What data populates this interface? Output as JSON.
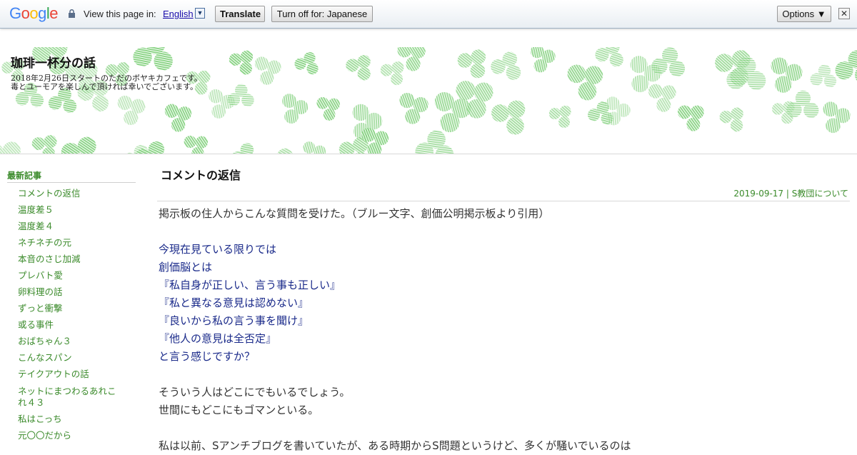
{
  "translate_bar": {
    "logo_letters": [
      "G",
      "o",
      "o",
      "g",
      "l",
      "e"
    ],
    "logo_colors": [
      "#4285f4",
      "#ea4335",
      "#fbbc05",
      "#4285f4",
      "#34a853",
      "#ea4335"
    ],
    "view_text": "View this page in:",
    "language": "English",
    "translate_label": "Translate",
    "turn_off_label": "Turn off for: Japanese",
    "options_label": "Options ▼",
    "close_label": "✕"
  },
  "header": {
    "title": "珈琲一杯分の話",
    "description_lines": [
      "2018年2月26日スタートのただのボヤキカフェです。",
      "毒とユーモアを楽しんで頂ければ幸いでございます。"
    ],
    "pattern_color": "#7fd07a"
  },
  "sidebar": {
    "heading": "最新記事",
    "items": [
      "コメントの返信",
      "温度差５",
      "温度差４",
      "ネチネチの元",
      "本音のさじ加減",
      "プレバト愛",
      "卵料理の話",
      "ずっと衝撃",
      "或る事件",
      "おばちゃん３",
      "こんなスパン",
      "テイクアウトの話",
      "ネットにまつわるあれこ",
      "れ４３",
      "私はこっち",
      "元〇〇だから"
    ]
  },
  "post": {
    "title": "コメントの返信",
    "meta": "2019-09-17 | S教団について",
    "lines": [
      {
        "text": "掲示板の住人からこんな質問を受けた。（ブルー文字、創価公明掲示板より引用）",
        "style": "normal"
      },
      {
        "text": "",
        "style": "normal"
      },
      {
        "text": "今現在見ている限りでは",
        "style": "blue"
      },
      {
        "text": "創価脳とは",
        "style": "blue"
      },
      {
        "text": "『私自身が正しい、言う事も正しい』",
        "style": "blue"
      },
      {
        "text": "『私と異なる意見は認めない』",
        "style": "blue"
      },
      {
        "text": "『良いから私の言う事を聞け』",
        "style": "blue"
      },
      {
        "text": "『他人の意見は全否定』",
        "style": "blue"
      },
      {
        "text": "と言う感じですか？",
        "style": "blue"
      },
      {
        "text": "",
        "style": "normal"
      },
      {
        "text": "そういう人はどこにでもいるでしょう。",
        "style": "normal"
      },
      {
        "text": "世間にもどこにもゴマンといる。",
        "style": "normal"
      },
      {
        "text": "",
        "style": "normal"
      },
      {
        "text": "私は以前、Sアンチブログを書いていたが、ある時期からS問題というけど、多くが騒いでいるのは",
        "style": "normal"
      }
    ]
  },
  "colors": {
    "accent_green": "#3a8a2a",
    "quote_blue": "#1a2a8a"
  }
}
